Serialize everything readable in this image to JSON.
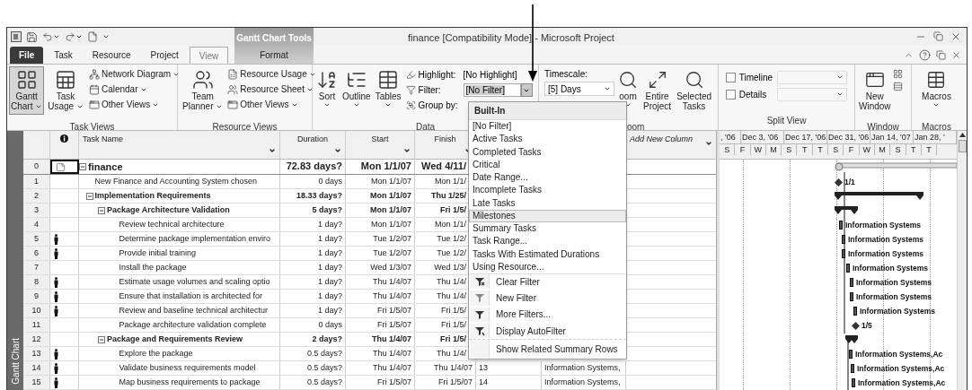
{
  "title_bar": {
    "contextual_group": "Gantt Chart Tools",
    "title": "finance [Compatibility Mode] - Microsoft Project"
  },
  "tabs": [
    {
      "label": "File",
      "kind": "file",
      "selected": false
    },
    {
      "label": "Task",
      "kind": "tab",
      "selected": false
    },
    {
      "label": "Resource",
      "kind": "tab",
      "selected": false
    },
    {
      "label": "Project",
      "kind": "tab",
      "selected": false
    },
    {
      "label": "View",
      "kind": "tab",
      "selected": true
    },
    {
      "label": "Format",
      "kind": "contextual",
      "selected": false
    }
  ],
  "ribbon": {
    "task_views": {
      "label": "Task Views",
      "large": [
        {
          "lines": [
            "Gantt",
            "Chart"
          ],
          "dropdown": true,
          "selected": true
        },
        {
          "lines": [
            "Task",
            "Usage"
          ],
          "dropdown": true,
          "selected": false
        }
      ],
      "small": [
        {
          "label": "Network Diagram"
        },
        {
          "label": "Calendar"
        },
        {
          "label": "Other Views"
        }
      ]
    },
    "resource_views": {
      "label": "Resource Views",
      "large": [
        {
          "lines": [
            "Team",
            "Planner"
          ],
          "dropdown": true,
          "selected": false
        }
      ],
      "small": [
        {
          "label": "Resource Usage"
        },
        {
          "label": "Resource Sheet"
        },
        {
          "label": "Other Views"
        }
      ]
    },
    "data": {
      "label": "Data",
      "large": [
        {
          "lines": [
            "Sort"
          ],
          "dropdown": true,
          "selected": false
        },
        {
          "lines": [
            "Outline"
          ],
          "dropdown": true,
          "selected": false
        },
        {
          "lines": [
            "Tables"
          ],
          "dropdown": true,
          "selected": false
        }
      ],
      "highlight": {
        "label": "Highlight:",
        "value": "[No Highlight]"
      },
      "filter": {
        "label": "Filter:",
        "value": "[No Filter]",
        "open": true
      },
      "group_by": {
        "label": "Group by:"
      }
    },
    "zoom": {
      "label": "oom",
      "timescale": {
        "label": "Timescale:",
        "value": "[5] Days"
      },
      "large": [
        {
          "lines": [
            "oom"
          ],
          "dropdown": true,
          "selected": false
        },
        {
          "lines": [
            "Entire",
            "Project"
          ],
          "dropdown": false,
          "selected": false
        },
        {
          "lines": [
            "Selected",
            "Tasks"
          ],
          "dropdown": false,
          "selected": false
        }
      ]
    },
    "split_view": {
      "label": "Split View",
      "options": [
        {
          "label": "Timeline",
          "checked": false
        },
        {
          "label": "Details",
          "checked": false
        }
      ]
    },
    "window": {
      "label": "Window",
      "large": [
        {
          "lines": [
            "New",
            "Window"
          ],
          "dropdown": false,
          "selected": false
        }
      ]
    },
    "macros": {
      "label": "Macros",
      "large": [
        {
          "lines": [
            "Macros"
          ],
          "dropdown": true,
          "selected": false
        }
      ]
    }
  },
  "filter_menu": {
    "header": "Built-In",
    "items": [
      {
        "label": "[No Filter]",
        "kind": "option",
        "selected": false
      },
      {
        "label": "Active Tasks",
        "kind": "option",
        "selected": false
      },
      {
        "label": "Completed Tasks",
        "kind": "option",
        "selected": false
      },
      {
        "label": "Critical",
        "kind": "option",
        "selected": false
      },
      {
        "label": "Date Range...",
        "kind": "option",
        "selected": false
      },
      {
        "label": "Incomplete Tasks",
        "kind": "option",
        "selected": false
      },
      {
        "label": "Late Tasks",
        "kind": "option",
        "selected": false
      },
      {
        "label": "Milestones",
        "kind": "option",
        "selected": true
      },
      {
        "label": "Summary Tasks",
        "kind": "option",
        "selected": false
      },
      {
        "label": "Task Range...",
        "kind": "option",
        "selected": false
      },
      {
        "label": "Tasks With Estimated Durations",
        "kind": "option",
        "selected": false
      },
      {
        "label": "Using Resource...",
        "kind": "option",
        "selected": false
      },
      {
        "label": "Clear Filter",
        "kind": "command",
        "selected": false
      },
      {
        "label": "New Filter",
        "kind": "command",
        "selected": false
      },
      {
        "label": "More Filters...",
        "kind": "command",
        "selected": false
      },
      {
        "label": "Display AutoFilter",
        "kind": "command",
        "selected": false
      },
      {
        "label": "Show Related Summary Rows",
        "kind": "footer",
        "selected": false
      }
    ]
  },
  "view_bar": {
    "label": "Gantt Chart"
  },
  "table": {
    "header": {
      "task_name": "Task Name",
      "duration": "Duration",
      "start": "Start",
      "finish": "Finish",
      "add_new_column": "Add New Column"
    },
    "tasks": [
      {
        "id": "0",
        "assigned": false,
        "note": true,
        "selected": true,
        "name": "finance",
        "duration": "72.83 days?",
        "start": "Mon 1/1/07",
        "finish": "Wed 4/11/",
        "expanded": true,
        "children": [
          {
            "id": "1",
            "assigned": false,
            "note": false,
            "selected": false,
            "name": "New Finance and Accounting System chosen",
            "duration": "0 days",
            "start": "Mon 1/1/07",
            "finish": "Mon 1/1/"
          },
          {
            "id": "2",
            "assigned": false,
            "note": false,
            "selected": false,
            "name": "Implementation Requirements",
            "duration": "18.33 days?",
            "start": "Mon 1/1/07",
            "finish": "Thu 1/25/",
            "expanded": true,
            "children": [
              {
                "id": "3",
                "assigned": false,
                "note": false,
                "selected": false,
                "name": "Package Architecture Validation",
                "duration": "5 days?",
                "start": "Mon 1/1/07",
                "finish": "Fri 1/5/",
                "expanded": true,
                "children": [
                  {
                    "id": "4",
                    "assigned": false,
                    "note": false,
                    "selected": false,
                    "name": "Review technical architecture",
                    "duration": "1 day?",
                    "start": "Mon 1/1/07",
                    "finish": "Mon 1/1/"
                  },
                  {
                    "id": "5",
                    "assigned": true,
                    "note": false,
                    "selected": false,
                    "name": "Determine package implementation enviro",
                    "duration": "1 day?",
                    "start": "Tue 1/2/07",
                    "finish": "Tue 1/2/"
                  },
                  {
                    "id": "6",
                    "assigned": true,
                    "note": false,
                    "selected": false,
                    "name": "Provide initial training",
                    "duration": "1 day?",
                    "start": "Tue 1/2/07",
                    "finish": "Tue 1/2/"
                  },
                  {
                    "id": "7",
                    "assigned": false,
                    "note": false,
                    "selected": false,
                    "name": "Install the package",
                    "duration": "1 day?",
                    "start": "Wed 1/3/07",
                    "finish": "Wed 1/3/"
                  },
                  {
                    "id": "8",
                    "assigned": true,
                    "note": false,
                    "selected": false,
                    "name": "Estimate usage volumes and scaling optio",
                    "duration": "1 day?",
                    "start": "Thu 1/4/07",
                    "finish": "Thu 1/4/"
                  },
                  {
                    "id": "9",
                    "assigned": true,
                    "note": false,
                    "selected": false,
                    "name": "Ensure that installation is architected for",
                    "duration": "1 day?",
                    "start": "Thu 1/4/07",
                    "finish": "Thu 1/4/"
                  },
                  {
                    "id": "10",
                    "assigned": true,
                    "note": false,
                    "selected": false,
                    "name": "Review and baseline technical architectur",
                    "duration": "1 day?",
                    "start": "Fri 1/5/07",
                    "finish": "Fri 1/5/"
                  },
                  {
                    "id": "11",
                    "assigned": false,
                    "note": false,
                    "selected": false,
                    "name": "Package architecture validation complete",
                    "duration": "0 days",
                    "start": "Fri 1/5/07",
                    "finish": "Fri 1/5/"
                  }
                ]
              },
              {
                "id": "12",
                "assigned": false,
                "note": false,
                "selected": false,
                "name": "Package and Requirements Review",
                "duration": "2 days?",
                "start": "Thu 1/4/07",
                "finish": "Fri 1/5/",
                "expanded": true,
                "children": [
                  {
                    "id": "13",
                    "assigned": true,
                    "note": false,
                    "selected": false,
                    "name": "Explore the package",
                    "duration": "0.5 days?",
                    "start": "Thu 1/4/07",
                    "finish": "Thu 1/4/"
                  },
                  {
                    "id": "14",
                    "assigned": true,
                    "note": false,
                    "selected": false,
                    "name": "Validate business requirements model",
                    "duration": "0.5 days?",
                    "start": "Thu 1/4/07",
                    "finish": "Thu 1/4/07",
                    "predecessors": "13",
                    "resources": "Information Systems,"
                  },
                  {
                    "id": "15",
                    "assigned": true,
                    "note": false,
                    "selected": false,
                    "name": "Map business requirements to package",
                    "duration": "0.5 days?",
                    "start": "Fri 1/5/07",
                    "finish": "Fri 1/5/07",
                    "predecessors": "14",
                    "resources": "Information Systems,"
                  }
                ]
              }
            ]
          }
        ]
      }
    ]
  },
  "gantt": {
    "major": [
      ", '06",
      "Dec 3, '06",
      "Dec 17, '06",
      "Dec 31, '06",
      "Jan 14, '07",
      "Jan 28, '"
    ],
    "minor": [
      "S",
      "F",
      "W",
      "M",
      "S",
      "T",
      "T",
      "S",
      "F",
      "W",
      "M",
      "S",
      "T",
      "T"
    ],
    "bars": [
      {
        "kind": "project"
      },
      {
        "kind": "milestone",
        "label": "1/1"
      },
      {
        "kind": "summary"
      },
      {
        "kind": "summary"
      },
      {
        "kind": "task",
        "label": "Information Systems"
      },
      {
        "kind": "task",
        "label": "Information Systems"
      },
      {
        "kind": "task",
        "label": "Information Systems"
      },
      {
        "kind": "task",
        "label": "Information Systems"
      },
      {
        "kind": "task",
        "label": "Information Systems"
      },
      {
        "kind": "task",
        "label": "Information Systems"
      },
      {
        "kind": "task",
        "label": "Information Systems"
      },
      {
        "kind": "milestone",
        "label": "1/5"
      },
      {
        "kind": "summary"
      },
      {
        "kind": "task",
        "label": "Information Systems,Ac"
      },
      {
        "kind": "task",
        "label": "Information Systems,Ac"
      },
      {
        "kind": "task",
        "label": "Information Systems,Ac"
      }
    ]
  }
}
